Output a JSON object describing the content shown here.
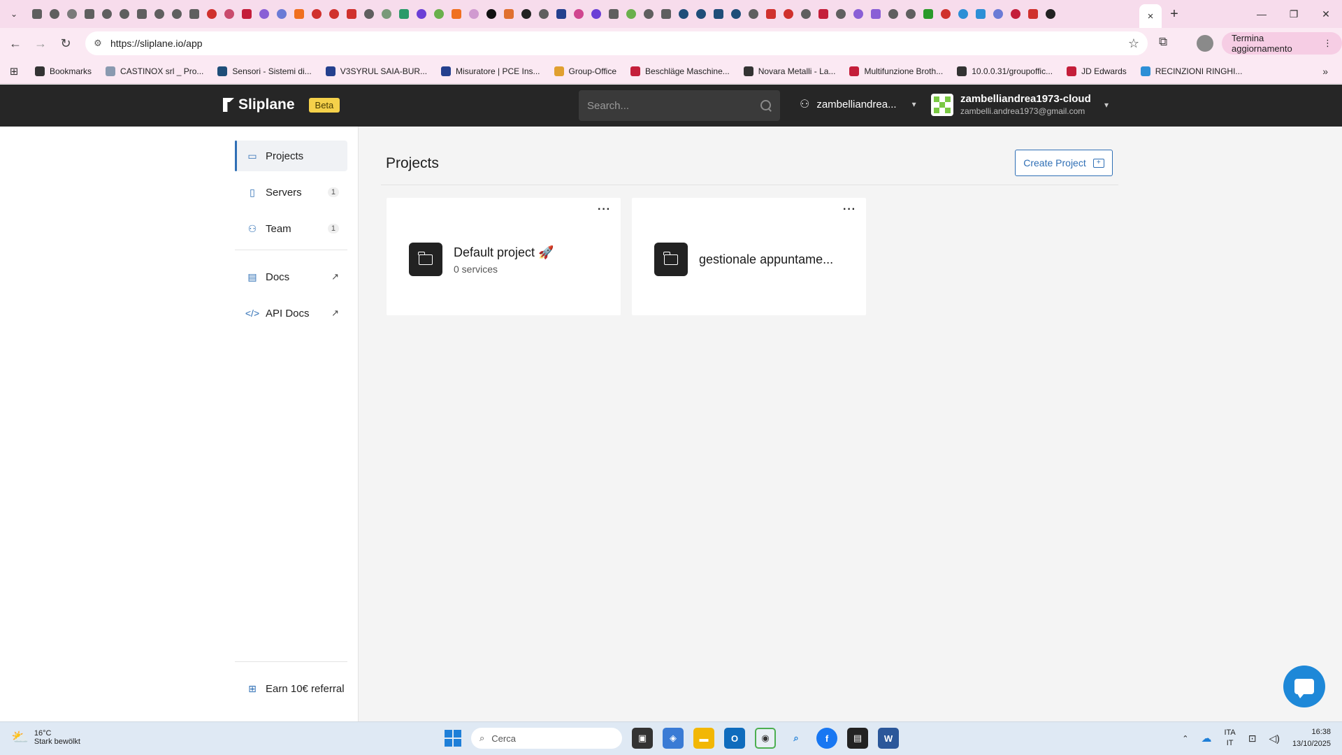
{
  "browser": {
    "tab_favicon_colors": [
      "#5f5f5f",
      "#5f5f5f",
      "#7a7a7a",
      "#5f5f5f",
      "#5f5f5f",
      "#5f5f5f",
      "#5f5f5f",
      "#5f5f5f",
      "#5f5f5f",
      "#5f5f5f",
      "#d0312d",
      "#c94b6d",
      "#c41e3a",
      "#8a5fd6",
      "#6b7bd6",
      "#f07020",
      "#d0312d",
      "#d0312d",
      "#d0312d",
      "#5f5f5f",
      "#7a9a7a",
      "#2a9a6a",
      "#6b3fd6",
      "#6ab04c",
      "#f07020",
      "#d09ad0",
      "#111111",
      "#e07030",
      "#222222",
      "#5f5f5f",
      "#24408e",
      "#d0458f",
      "#6b3fd6",
      "#5f5f5f",
      "#6ab04c",
      "#5f5f5f",
      "#5f5f5f",
      "#1f4e79",
      "#1f4e79",
      "#1f4e79",
      "#1f4e79",
      "#5f5f5f",
      "#d0312d",
      "#d0312d",
      "#5f5f5f",
      "#c41e3a",
      "#5f5f5f",
      "#8a5fd6",
      "#8a5fd6",
      "#5f5f5f",
      "#5f5f5f",
      "#2a9a2a",
      "#d0312d",
      "#2d8fd6",
      "#2d8fd6",
      "#6b7bd6",
      "#c41e3a",
      "#d0312d",
      "#222222"
    ],
    "active_tab_close": "×",
    "new_tab": "+",
    "url": "https://sliplane.io/app",
    "update_button": "Termina aggiornamento",
    "bookmarks": [
      {
        "label": "Bookmarks",
        "color": "#333333"
      },
      {
        "label": "CASTINOX srl _ Pro...",
        "color": "#8a9ab0"
      },
      {
        "label": "Sensori - Sistemi di...",
        "color": "#1f4e79"
      },
      {
        "label": "V3SYRUL SAIA-BUR...",
        "color": "#24408e"
      },
      {
        "label": "Misuratore | PCE Ins...",
        "color": "#24408e"
      },
      {
        "label": "Group-Office",
        "color": "#e0a030"
      },
      {
        "label": "Beschläge Maschine...",
        "color": "#c41e3a"
      },
      {
        "label": "Novara Metalli - La...",
        "color": "#333333"
      },
      {
        "label": "Multifunzione Broth...",
        "color": "#c41e3a"
      },
      {
        "label": "10.0.0.31/groupoffic...",
        "color": "#333333"
      },
      {
        "label": "JD Edwards",
        "color": "#c41e3a"
      },
      {
        "label": "RECINZIONI RINGHI...",
        "color": "#2d8fd6"
      }
    ]
  },
  "header": {
    "brand": "Sliplane",
    "badge": "Beta",
    "search_placeholder": "Search...",
    "org_name": "zambelliandrea...",
    "account_name": "zambelliandrea1973-cloud",
    "account_email": "zambelli.andrea1973@gmail.com"
  },
  "sidebar": {
    "items": [
      {
        "label": "Projects",
        "icon": "folder-icon",
        "active": true
      },
      {
        "label": "Servers",
        "icon": "server-icon",
        "badge": "1"
      },
      {
        "label": "Team",
        "icon": "team-icon",
        "badge": "1"
      }
    ],
    "links": [
      {
        "label": "Docs",
        "icon": "document-icon"
      },
      {
        "label": "API Docs",
        "icon": "code-icon"
      }
    ],
    "referral": "Earn 10€ referral"
  },
  "main": {
    "title": "Projects",
    "create_button": "Create Project",
    "projects": [
      {
        "name": "Default project 🚀",
        "services": "0 services"
      },
      {
        "name": "gestionale appuntame...",
        "services": ""
      }
    ]
  },
  "taskbar": {
    "weather_temp": "16°C",
    "weather_desc": "Stark bewölkt",
    "search_placeholder": "Cerca",
    "lang_1": "ITA",
    "lang_2": "IT",
    "time": "16:38",
    "date": "13/10/2025",
    "accent": "#1e7fd8"
  }
}
